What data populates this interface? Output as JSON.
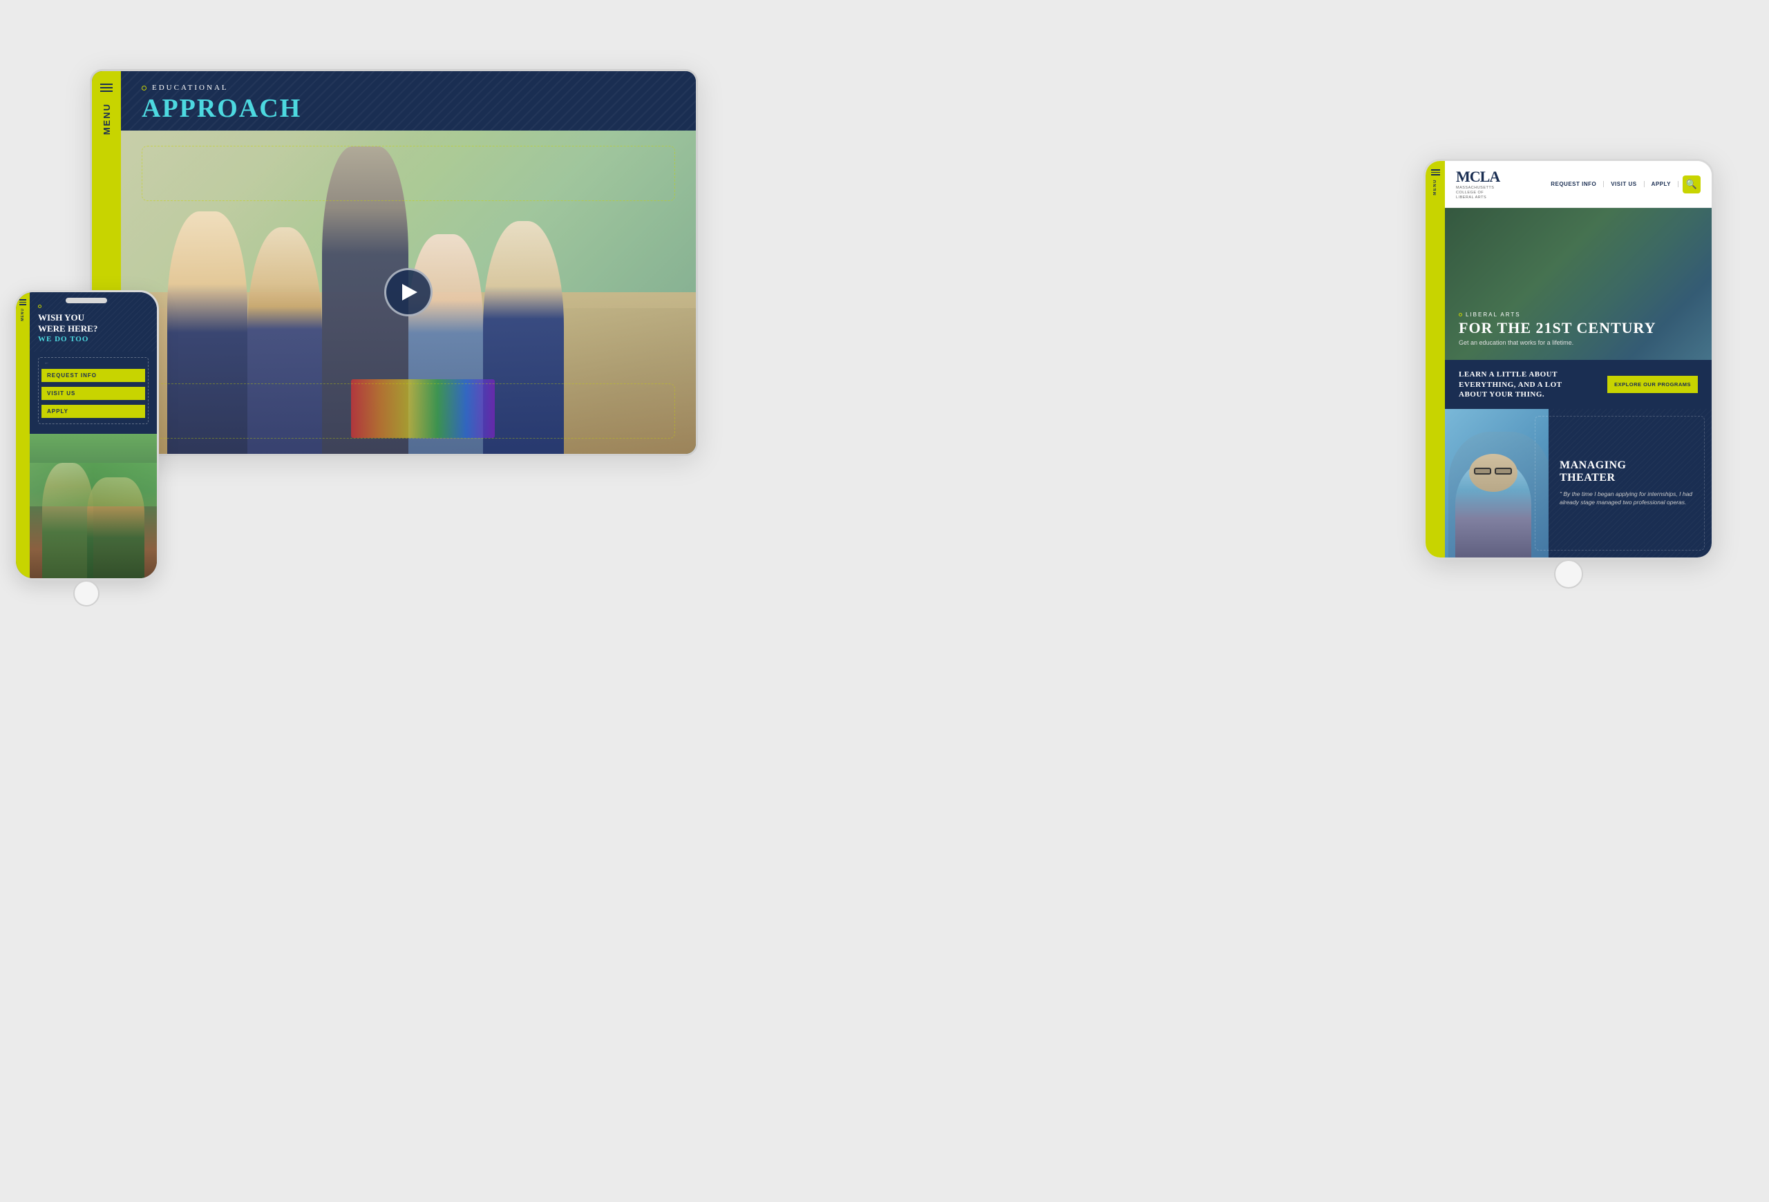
{
  "scene": {
    "background": "#ebebeb"
  },
  "laptop": {
    "sidebar": {
      "menu_lines": 3,
      "menu_label": "MENU"
    },
    "header": {
      "subtitle": "EDUCATIONAL",
      "title": "APPROACH"
    },
    "video": {
      "play_button_label": "Play"
    }
  },
  "phone": {
    "sidebar": {
      "menu_label": "MENU"
    },
    "hero": {
      "title_line1": "WISH YOU",
      "title_line2": "WERE HERE?",
      "title_line3": "WE DO TOO"
    },
    "cta_buttons": {
      "request_info": "REQUEST INFO",
      "visit_us": "VISIT US",
      "apply": "APPLY"
    }
  },
  "tablet": {
    "nav": {
      "logo": "MCLA",
      "logo_subtitle": "MASSACHUSETTS\nCOLLEGE OF LIBERAL ARTS",
      "links": [
        "REQUEST INFO",
        "VISIT US",
        "APPLY"
      ],
      "search_icon": "🔍"
    },
    "hero": {
      "subtitle": "LIBERAL ARTS",
      "title_line1": "FOR THE 21ST CENTURY",
      "description": "Get an education that works for a lifetime."
    },
    "section1": {
      "text": "LEARN A LITTLE ABOUT EVERYTHING, AND A LOT ABOUT YOUR THING.",
      "button_label": "EXPLORE OUR PROGRAMS"
    },
    "section2": {
      "title_line1": "MANAGING",
      "title_line2": "THEATER",
      "quote": "\" By the time I began applying for internships, I had already stage managed two professional operas."
    }
  }
}
